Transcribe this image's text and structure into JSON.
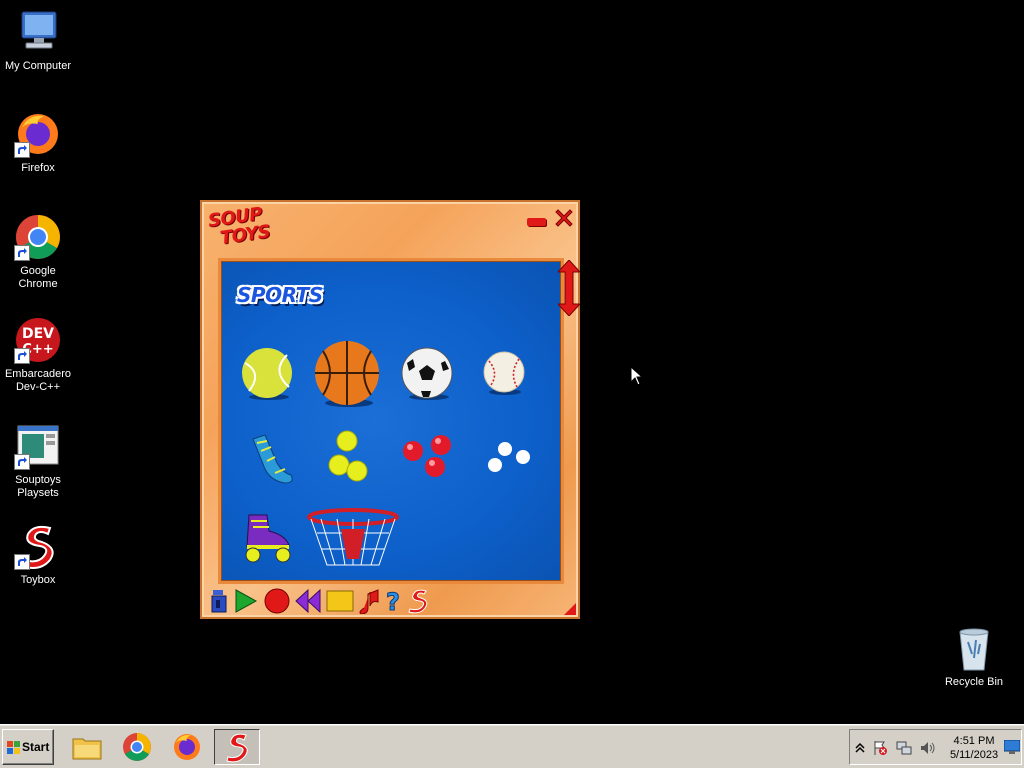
{
  "desktop": {
    "icons": [
      {
        "label": "My Computer",
        "icon": "computer-icon"
      },
      {
        "label": "Firefox",
        "icon": "firefox-icon"
      },
      {
        "label": "Google Chrome",
        "icon": "chrome-icon"
      },
      {
        "label": "Embarcadero\nDev-C++",
        "icon": "devcpp-icon",
        "badge": "DEV C++"
      },
      {
        "label": "Souptoys\nPlaysets",
        "icon": "playsets-icon"
      },
      {
        "label": "Toybox",
        "icon": "toybox-icon"
      },
      {
        "label": "Recycle Bin",
        "icon": "recycle-bin-icon"
      }
    ]
  },
  "soup_window": {
    "logo_line1": "SOUP",
    "logo_line2": "TOYS",
    "section_title": "SPORTS",
    "toys": [
      {
        "name": "tennis-ball-icon"
      },
      {
        "name": "basketball-icon"
      },
      {
        "name": "soccer-ball-icon"
      },
      {
        "name": "baseball-icon"
      },
      {
        "name": "sock-icon"
      },
      {
        "name": "yellow-balls-icon"
      },
      {
        "name": "red-balls-icon"
      },
      {
        "name": "white-balls-icon"
      },
      {
        "name": "roller-skate-icon"
      },
      {
        "name": "basketball-hoop-icon"
      }
    ],
    "toolbar": [
      {
        "name": "magnet-icon"
      },
      {
        "name": "play-icon"
      },
      {
        "name": "record-icon"
      },
      {
        "name": "rewind-icon"
      },
      {
        "name": "stop-icon"
      },
      {
        "name": "sound-icon"
      },
      {
        "name": "help-icon"
      },
      {
        "name": "soup-logo-icon"
      }
    ],
    "colors": {
      "frame": "#f5a35a",
      "play_area": "#0d5fc9",
      "accent": "#e01818"
    }
  },
  "taskbar": {
    "start_label": "Start",
    "buttons": [
      {
        "name": "explorer-icon"
      },
      {
        "name": "chrome-icon"
      },
      {
        "name": "firefox-icon"
      },
      {
        "name": "toybox-icon"
      }
    ],
    "clock_time": "4:51 PM",
    "clock_date": "5/11/2023"
  }
}
